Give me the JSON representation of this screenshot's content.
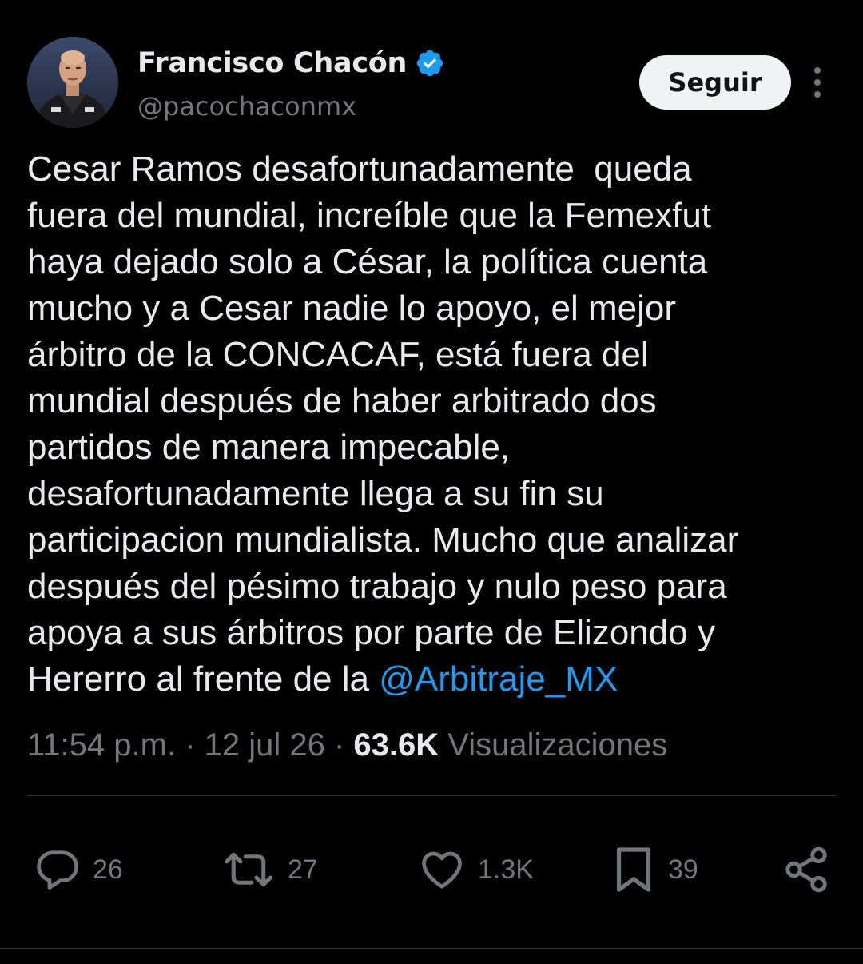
{
  "author": {
    "display_name": "Francisco Chacón",
    "handle": "@pacochaconmx",
    "verified": true
  },
  "follow_label": "Seguir",
  "tweet": {
    "lines": [
      "Cesar Ramos desafortunadamente  queda",
      "fuera del mundial, increíble que la Femexfut",
      "haya dejado solo a César, la política cuenta",
      "mucho y a Cesar nadie lo apoyo, el mejor",
      "árbitro de la CONCACAF, está fuera del",
      "mundial después de haber arbitrado dos",
      "partidos de manera impecable,",
      "desafortunadamente llega a su fin su",
      "participacion mundialista. Mucho que analizar",
      "después del pésimo trabajo y nulo peso para",
      "apoya a sus árbitros por parte de Elizondo y"
    ],
    "last_line_prefix": "Hererro al frente de la ",
    "mention": "@Arbitraje_MX"
  },
  "meta": {
    "time": "11:54 p.m.",
    "date": "12 jul 26",
    "separator": " · ",
    "views_count": "63.6K",
    "views_label": " Visualizaciones"
  },
  "actions": {
    "replies": "26",
    "retweets": "27",
    "likes": "1.3K",
    "bookmarks": "39"
  },
  "colors": {
    "background": "#000000",
    "text": "#e7e9ea",
    "secondary": "#71767b",
    "accent": "#1d9bf0",
    "follow_button_bg": "#eff3f4",
    "divider": "#2f3336"
  },
  "icons": {
    "verified": "verified-badge-icon",
    "more": "more-options-icon",
    "reply": "reply-icon",
    "retweet": "retweet-icon",
    "like": "heart-icon",
    "bookmark": "bookmark-icon",
    "share": "share-icon"
  }
}
